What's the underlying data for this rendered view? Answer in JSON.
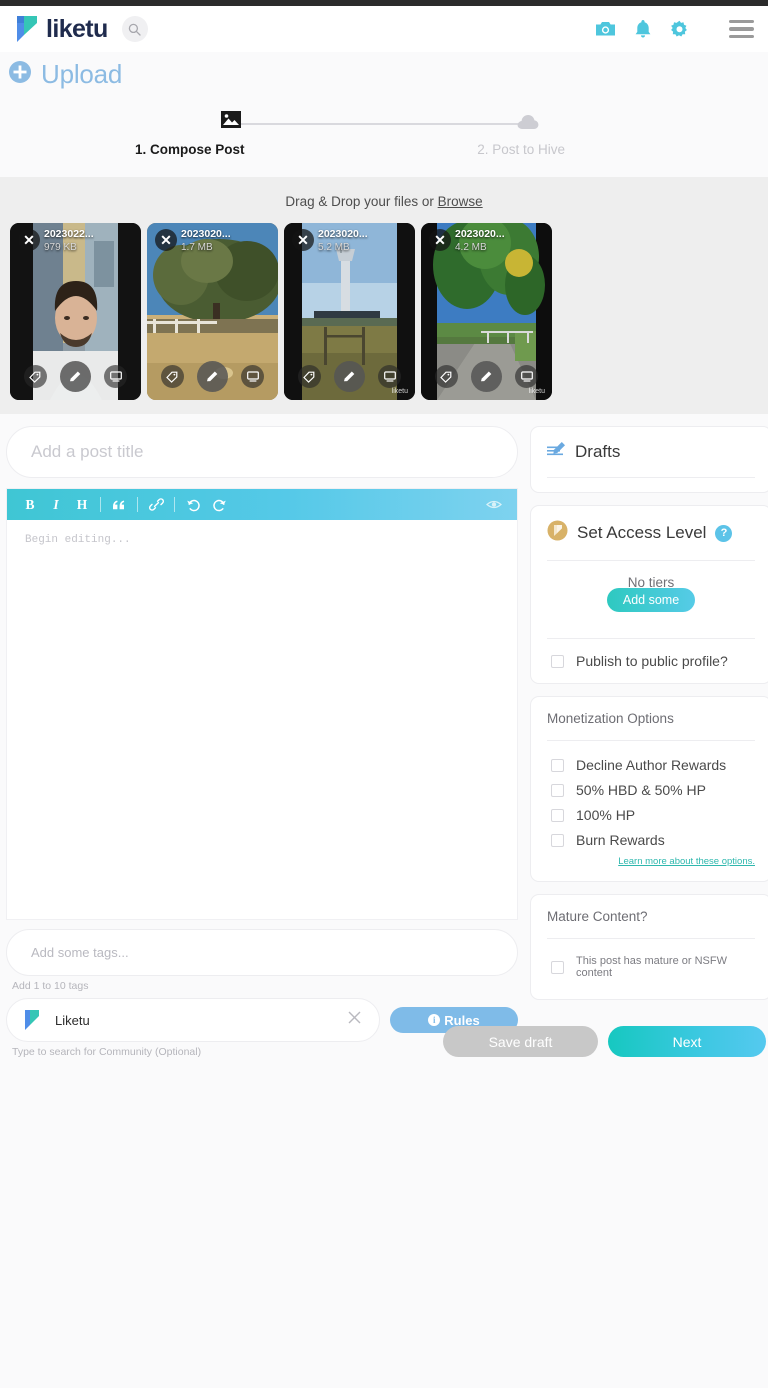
{
  "header": {
    "brand": "liketu",
    "icons": {
      "search": "search-icon",
      "camera": "camera-icon",
      "bell": "bell-icon",
      "gear": "gear-icon",
      "menu": "hamburger-menu-icon"
    }
  },
  "upload_bar": {
    "label": "Upload",
    "plus_icon": "plus-circle-icon"
  },
  "stepper": {
    "step1_label": "1. Compose Post",
    "step2_label": "2. Post to Hive",
    "step1_icon": "image-icon",
    "step2_icon": "cloud-upload-icon"
  },
  "dropzone": {
    "prompt_prefix": "Drag & Drop your files or ",
    "browse_label": "Browse",
    "files": [
      {
        "name": "2023022...",
        "size": "979 KB",
        "kind": "portrait-selfie"
      },
      {
        "name": "2023020...",
        "size": "1.7 MB",
        "kind": "tree-field"
      },
      {
        "name": "2023020...",
        "size": "5.2 MB",
        "kind": "control-tower"
      },
      {
        "name": "2023020...",
        "size": "4.2 MB",
        "kind": "palm-road"
      }
    ],
    "thumb_tools": [
      "tag-icon",
      "pencil-edit-icon",
      "caption-icon"
    ],
    "close_glyph": "✕",
    "watermark": "liketu"
  },
  "composer": {
    "title_placeholder": "Add a post title",
    "title_value": "",
    "toolbar": {
      "bold": "B",
      "italic": "I",
      "heading": "H",
      "quote": "“",
      "link": "link-icon",
      "undo": "undo-icon",
      "redo": "redo-icon",
      "preview": "eye-preview-icon"
    },
    "body_placeholder": "Begin editing...",
    "body_value": "",
    "tags_placeholder": "Add some tags...",
    "tags_hint": "Add 1 to 10 tags",
    "community_name": "Liketu",
    "community_hint": "Type to search for Community (Optional)",
    "community_clear_icon": "close-x-icon",
    "rules_label": "Rules",
    "rules_icon": "info-icon"
  },
  "sidebar": {
    "drafts": {
      "label": "Drafts",
      "icon": "draft-pencil-icon"
    },
    "access": {
      "label": "Set Access Level",
      "icon": "liketu-gold-icon",
      "help_icon": "question-mark-icon",
      "no_tiers_label": "No tiers",
      "add_some_label": "Add some",
      "publish_public_label": "Publish to public profile?"
    },
    "monetization": {
      "heading": "Monetization Options",
      "options": [
        "Decline Author Rewards",
        "50% HBD & 50% HP",
        "100% HP",
        "Burn Rewards"
      ],
      "learn_more": "Learn more about these options."
    },
    "mature": {
      "heading": "Mature Content?",
      "checkbox_label": "This post has mature or NSFW content"
    }
  },
  "footer": {
    "save_draft_label": "Save draft",
    "next_label": "Next"
  },
  "colors": {
    "brand_navy": "#1f2b4d",
    "teal": "#4ec6dd",
    "upload_blue": "#8cbbe3",
    "next_gradient_start": "#16c8c0",
    "next_gradient_end": "#55c9ef",
    "rules_blue": "#7fbbe8",
    "link_teal": "#2fb8ae"
  }
}
